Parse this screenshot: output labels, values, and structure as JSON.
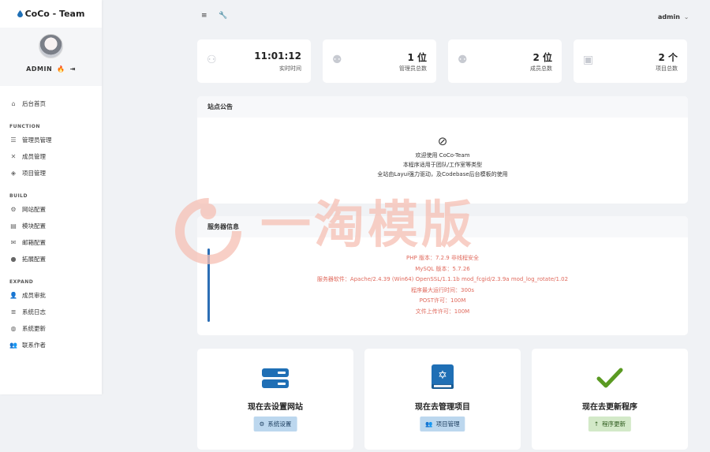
{
  "app": {
    "brand": "CoCo - Team"
  },
  "sidebar": {
    "user": "ADMIN",
    "home": "后台首页",
    "sections": [
      {
        "title": "FUNCTION",
        "items": [
          {
            "label": "管理员管理",
            "icon": "list-icon"
          },
          {
            "label": "成员管理",
            "icon": "tools-icon"
          },
          {
            "label": "项目管理",
            "icon": "layers-icon"
          }
        ]
      },
      {
        "title": "BUILD",
        "items": [
          {
            "label": "网站配置",
            "icon": "cogs-icon"
          },
          {
            "label": "模块配置",
            "icon": "server-icon"
          },
          {
            "label": "邮箱配置",
            "icon": "envelope-open-icon"
          },
          {
            "label": "拓展配置",
            "icon": "bomb-icon"
          }
        ]
      },
      {
        "title": "EXPAND",
        "items": [
          {
            "label": "成员审批",
            "icon": "user-plus-icon"
          },
          {
            "label": "系统日志",
            "icon": "log-list-icon"
          },
          {
            "label": "系统更新",
            "icon": "globe-icon"
          },
          {
            "label": "联系作者",
            "icon": "users-icon"
          }
        ]
      }
    ]
  },
  "header": {
    "user": "admin"
  },
  "stats": [
    {
      "value": "11:01:12",
      "label": "实时时间",
      "icon": "sitemap-icon"
    },
    {
      "value": "1 位",
      "label": "管理员总数",
      "icon": "users-group-icon"
    },
    {
      "value": "2 位",
      "label": "成员总数",
      "icon": "users-icon"
    },
    {
      "value": "2 个",
      "label": "项目总数",
      "icon": "briefcase-icon"
    }
  ],
  "notice": {
    "title": "站点公告",
    "lines": [
      "欢迎使用 CoCo-Team",
      "本程序适用于团队/工作室等类型",
      "全站由Layui强力驱动，及Codebase后台模板的使用"
    ]
  },
  "server": {
    "title": "服务器信息",
    "lines": [
      "PHP 版本：7.2.9 非线程安全",
      "MySQL 版本：5.7.26",
      "服务器软件：Apache/2.4.39 (Win64) OpenSSL/1.1.1b mod_fcgid/2.3.9a mod_log_rotate/1.02",
      "程序最大运行时间：300s",
      "POST许可：100M",
      "文件上传许可：100M"
    ]
  },
  "actions": [
    {
      "title": "现在去设置网站",
      "button": "系统设置",
      "icon": "server-stack-icon"
    },
    {
      "title": "现在去管理项目",
      "button": "项目管理",
      "icon": "book-star-icon"
    },
    {
      "title": "现在去更新程序",
      "button": "程序更新",
      "icon": "check-icon"
    }
  ],
  "watermark": {
    "text": "一淘模版"
  },
  "colors": {
    "accent": "#1f6fb5",
    "check": "#5a9a22",
    "server_text": "#e06a5d"
  }
}
